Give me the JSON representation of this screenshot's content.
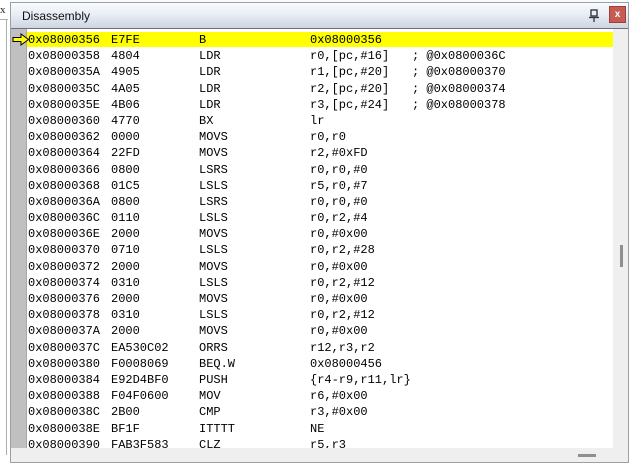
{
  "window": {
    "title": "Disassembly",
    "pin_icon": "pin-icon",
    "close_icon": "x",
    "adjacent_close_glyph": "x"
  },
  "colors": {
    "highlight_row": "#ffff00",
    "close_button": "#c75b52",
    "gutter": "#c0c0c0",
    "titlebar_top": "#f9fbfd",
    "titlebar_bottom": "#ccd5e1",
    "scroll_thumb": "#8f8f8f"
  },
  "disassembly": {
    "current_address": "0x08000356",
    "rows": [
      {
        "addr": "0x08000356",
        "code": "E7FE",
        "mn": "B",
        "ops": "0x08000356",
        "cmt": "",
        "current": true
      },
      {
        "addr": "0x08000358",
        "code": "4804",
        "mn": "LDR",
        "ops": "r0,[pc,#16]",
        "cmt": "; @0x0800036C",
        "current": false
      },
      {
        "addr": "0x0800035A",
        "code": "4905",
        "mn": "LDR",
        "ops": "r1,[pc,#20]",
        "cmt": "; @0x08000370",
        "current": false
      },
      {
        "addr": "0x0800035C",
        "code": "4A05",
        "mn": "LDR",
        "ops": "r2,[pc,#20]",
        "cmt": "; @0x08000374",
        "current": false
      },
      {
        "addr": "0x0800035E",
        "code": "4B06",
        "mn": "LDR",
        "ops": "r3,[pc,#24]",
        "cmt": "; @0x08000378",
        "current": false
      },
      {
        "addr": "0x08000360",
        "code": "4770",
        "mn": "BX",
        "ops": "lr",
        "cmt": "",
        "current": false
      },
      {
        "addr": "0x08000362",
        "code": "0000",
        "mn": "MOVS",
        "ops": "r0,r0",
        "cmt": "",
        "current": false
      },
      {
        "addr": "0x08000364",
        "code": "22FD",
        "mn": "MOVS",
        "ops": "r2,#0xFD",
        "cmt": "",
        "current": false
      },
      {
        "addr": "0x08000366",
        "code": "0800",
        "mn": "LSRS",
        "ops": "r0,r0,#0",
        "cmt": "",
        "current": false
      },
      {
        "addr": "0x08000368",
        "code": "01C5",
        "mn": "LSLS",
        "ops": "r5,r0,#7",
        "cmt": "",
        "current": false
      },
      {
        "addr": "0x0800036A",
        "code": "0800",
        "mn": "LSRS",
        "ops": "r0,r0,#0",
        "cmt": "",
        "current": false
      },
      {
        "addr": "0x0800036C",
        "code": "0110",
        "mn": "LSLS",
        "ops": "r0,r2,#4",
        "cmt": "",
        "current": false
      },
      {
        "addr": "0x0800036E",
        "code": "2000",
        "mn": "MOVS",
        "ops": "r0,#0x00",
        "cmt": "",
        "current": false
      },
      {
        "addr": "0x08000370",
        "code": "0710",
        "mn": "LSLS",
        "ops": "r0,r2,#28",
        "cmt": "",
        "current": false
      },
      {
        "addr": "0x08000372",
        "code": "2000",
        "mn": "MOVS",
        "ops": "r0,#0x00",
        "cmt": "",
        "current": false
      },
      {
        "addr": "0x08000374",
        "code": "0310",
        "mn": "LSLS",
        "ops": "r0,r2,#12",
        "cmt": "",
        "current": false
      },
      {
        "addr": "0x08000376",
        "code": "2000",
        "mn": "MOVS",
        "ops": "r0,#0x00",
        "cmt": "",
        "current": false
      },
      {
        "addr": "0x08000378",
        "code": "0310",
        "mn": "LSLS",
        "ops": "r0,r2,#12",
        "cmt": "",
        "current": false
      },
      {
        "addr": "0x0800037A",
        "code": "2000",
        "mn": "MOVS",
        "ops": "r0,#0x00",
        "cmt": "",
        "current": false
      },
      {
        "addr": "0x0800037C",
        "code": "EA530C02",
        "mn": "ORRS",
        "ops": "r12,r3,r2",
        "cmt": "",
        "current": false
      },
      {
        "addr": "0x08000380",
        "code": "F0008069",
        "mn": "BEQ.W",
        "ops": "0x08000456",
        "cmt": "",
        "current": false
      },
      {
        "addr": "0x08000384",
        "code": "E92D4BF0",
        "mn": "PUSH",
        "ops": "{r4-r9,r11,lr}",
        "cmt": "",
        "current": false
      },
      {
        "addr": "0x08000388",
        "code": "F04F0600",
        "mn": "MOV",
        "ops": "r6,#0x00",
        "cmt": "",
        "current": false
      },
      {
        "addr": "0x0800038C",
        "code": "2B00",
        "mn": "CMP",
        "ops": "r3,#0x00",
        "cmt": "",
        "current": false
      },
      {
        "addr": "0x0800038E",
        "code": "BF1F",
        "mn": "ITTTT",
        "ops": "NE",
        "cmt": "",
        "current": false
      },
      {
        "addr": "0x08000390",
        "code": "FAB3F583",
        "mn": "CLZ",
        "ops": "r5,r3",
        "cmt": "",
        "current": false
      }
    ]
  }
}
